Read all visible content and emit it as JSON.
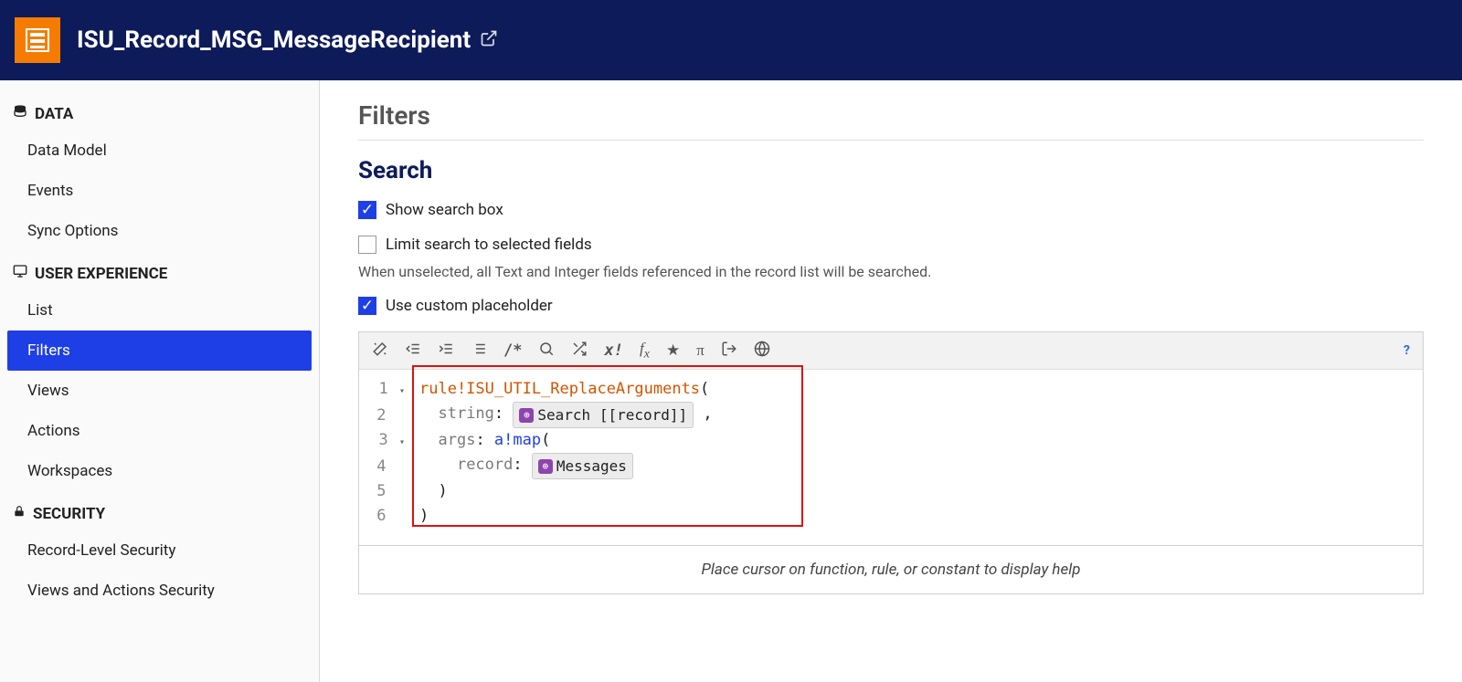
{
  "header": {
    "title": "ISU_Record_MSG_MessageRecipient"
  },
  "sidebar": {
    "sections": [
      {
        "label": "DATA",
        "icon": "database-icon",
        "items": [
          {
            "label": "Data Model"
          },
          {
            "label": "Events"
          },
          {
            "label": "Sync Options"
          }
        ]
      },
      {
        "label": "USER EXPERIENCE",
        "icon": "monitor-icon",
        "items": [
          {
            "label": "List"
          },
          {
            "label": "Filters"
          },
          {
            "label": "Views"
          },
          {
            "label": "Actions"
          },
          {
            "label": "Workspaces"
          }
        ]
      },
      {
        "label": "SECURITY",
        "icon": "lock-icon",
        "items": [
          {
            "label": "Record-Level Security"
          },
          {
            "label": "Views and Actions Security"
          }
        ]
      }
    ]
  },
  "main": {
    "page_title": "Filters",
    "section_title": "Search",
    "show_search_box": {
      "label": "Show search box",
      "checked": true
    },
    "limit_search": {
      "label": "Limit search to selected fields",
      "checked": false
    },
    "limit_help": "When unselected, all Text and Integer fields referenced in the record list will be searched.",
    "custom_placeholder": {
      "label": "Use custom placeholder",
      "checked": true
    },
    "toolbar_icons": [
      "magic-wand-icon",
      "outdent-icon",
      "indent-icon",
      "list-icon",
      "comment-icon",
      "search-icon",
      "shuffle-icon",
      "x-bang-icon",
      "fx-icon",
      "star-icon",
      "pi-icon",
      "export-icon",
      "globe-icon"
    ],
    "code": {
      "lines": [
        "1",
        "2",
        "3",
        "4",
        "5",
        "6"
      ],
      "rule_name": "rule!ISU_UTIL_ReplaceArguments",
      "param_string": "string",
      "chip_search": "Search [[record]]",
      "param_args": "args",
      "func_map": "a!map",
      "param_record": "record",
      "chip_messages": "Messages"
    },
    "hint": "Place cursor on function, rule, or constant to display help"
  }
}
